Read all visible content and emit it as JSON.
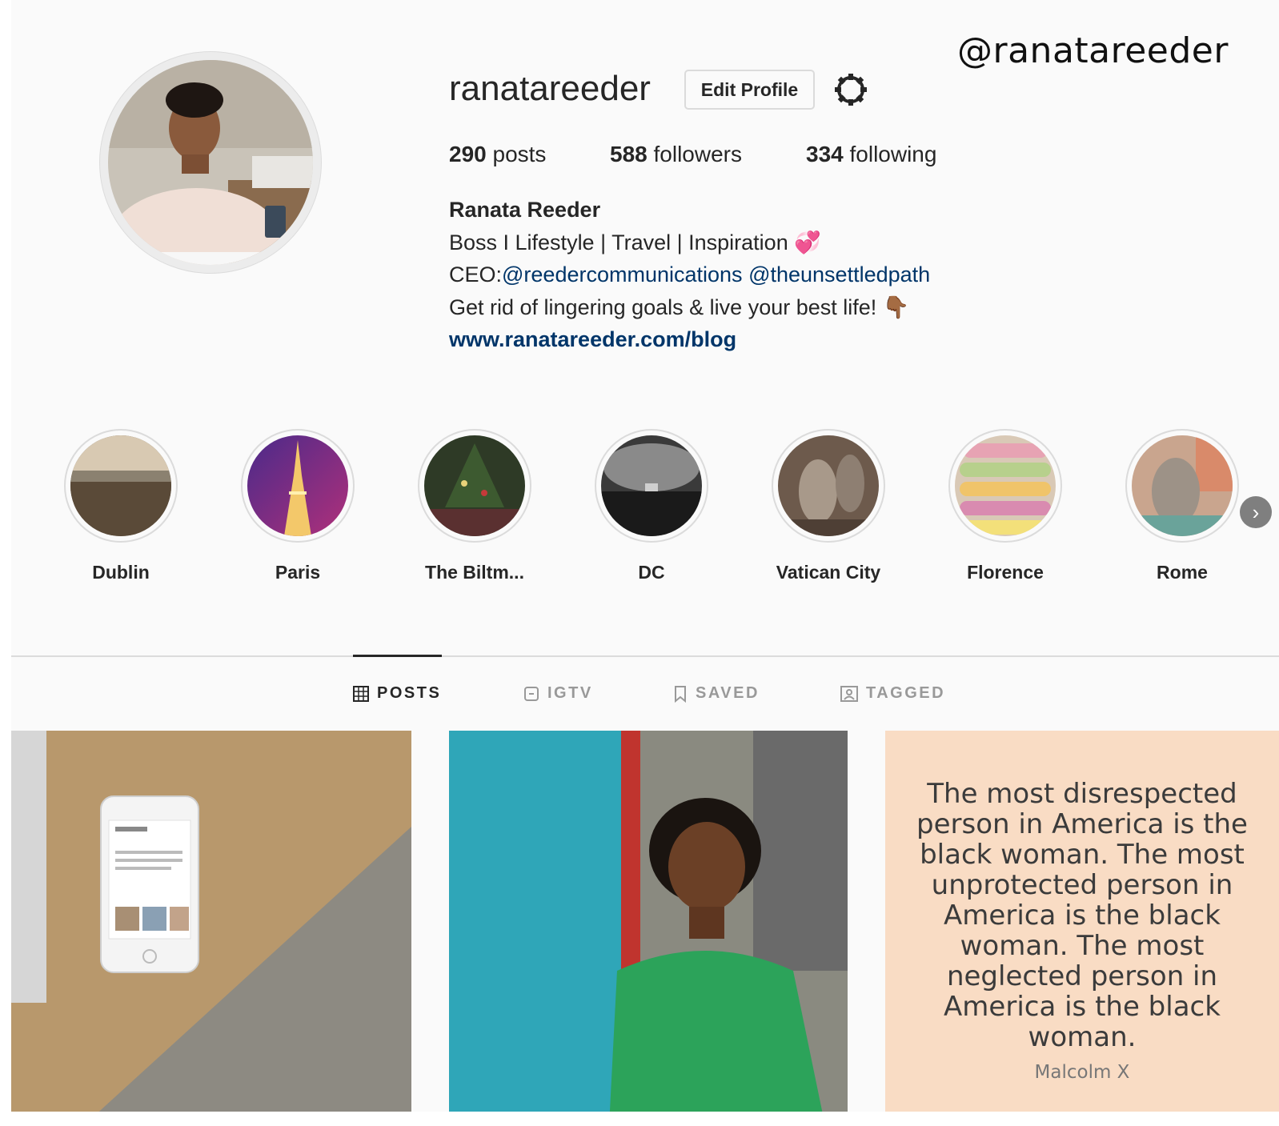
{
  "watermark": "@ranatareeder",
  "profile": {
    "username": "ranatareeder",
    "edit_label": "Edit Profile",
    "stats": {
      "posts_count": "290",
      "posts_label": "posts",
      "followers_count": "588",
      "followers_label": "followers",
      "following_count": "334",
      "following_label": "following"
    },
    "bio": {
      "name": "Ranata Reeder",
      "line1": "Boss I Lifestyle | Travel | Inspiration",
      "line1_emoji": "💞",
      "line2_prefix": "CEO:",
      "mention1": "@reedercommunications",
      "mention2": "@theunsettledpath",
      "line3": "Get rid of lingering goals & live your best life!",
      "line3_emoji": "👇🏾",
      "link": "www.ranatareeder.com/blog"
    }
  },
  "highlights": [
    {
      "label": "Dublin"
    },
    {
      "label": "Paris"
    },
    {
      "label": "The Biltm..."
    },
    {
      "label": "DC"
    },
    {
      "label": "Vatican City"
    },
    {
      "label": "Florence"
    },
    {
      "label": "Rome"
    }
  ],
  "tabs": [
    {
      "label": "POSTS",
      "icon": "grid-icon",
      "active": true
    },
    {
      "label": "IGTV",
      "icon": "tv-icon",
      "active": false
    },
    {
      "label": "SAVED",
      "icon": "bookmark-icon",
      "active": false
    },
    {
      "label": "TAGGED",
      "icon": "tag-icon",
      "active": false
    }
  ],
  "posts": {
    "quote_lines": [
      "The most disrespected",
      "person in America is the",
      "black woman. The most",
      "unprotected person in",
      "America is the black",
      "woman. The most",
      "neglected person in",
      "America is the black",
      "woman."
    ],
    "quote_author": "Malcolm X"
  },
  "colors": {
    "background": "#fafafa",
    "text": "#262626",
    "link": "#003569",
    "border": "#dbdbdb",
    "quote_background": "#f9dcc4"
  }
}
